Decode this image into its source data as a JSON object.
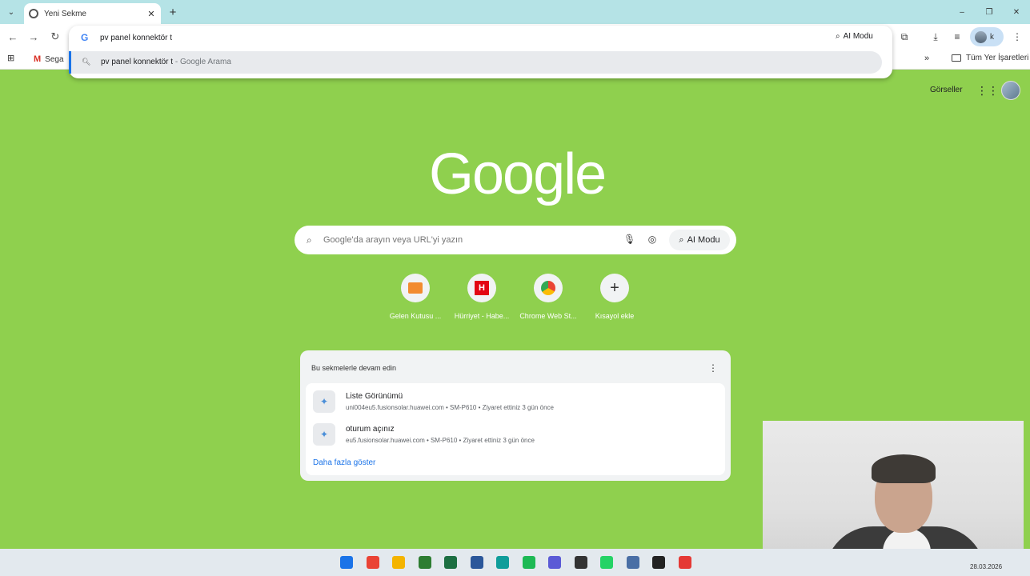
{
  "browser": {
    "tab_title": "Yeni Sekme",
    "tab_menu_icon": "chevron-down-icon",
    "newtab_icon": "+",
    "window_controls": [
      "–",
      "❐",
      "✕"
    ]
  },
  "toolbar": {
    "back": "←",
    "forward": "→",
    "reload": "↻",
    "ai_mode_label": "AI Modu",
    "profile_letter": "k"
  },
  "omnibox": {
    "value": "pv panel konnektör t",
    "suggestion_query": "pv panel konnektör t",
    "suggestion_suffix": " - Google Arama"
  },
  "bookmarks": {
    "gmail_label": "Sega",
    "more": "»",
    "all_bookmarks": "Tüm Yer İşaretleri"
  },
  "ntp": {
    "images_label": "Görseller",
    "logo": "Google",
    "search_placeholder": "Google'da arayın veya URL'yi yazın",
    "ai_mode_label": "AI Modu",
    "shortcuts": [
      {
        "label": "Gelen Kutusu ..."
      },
      {
        "label": "Hürriyet - Habe..."
      },
      {
        "label": "Chrome Web St..."
      },
      {
        "label": "Kısayol ekle"
      }
    ]
  },
  "continue_card": {
    "title": "Bu sekmelerle devam edin",
    "items": [
      {
        "title": "Liste Görünümü",
        "subtitle": "uni004eu5.fusionsolar.huawei.com • SM-P610 • Ziyaret ettiniz 3 gün önce"
      },
      {
        "title": "oturum açınız",
        "subtitle": "eu5.fusionsolar.huawei.com • SM-P610 • Ziyaret ettiniz 3 gün önce"
      }
    ],
    "more_label": "Daha fazla göster"
  },
  "taskbar": {
    "date": "28.03.2026",
    "icon_colors": [
      "#1a73e8",
      "#ea4335",
      "#f4b400",
      "#2e7d32",
      "#1d6f42",
      "#2b579a",
      "#0f9d9a",
      "#1db954",
      "#5b5bd6",
      "#333333",
      "#25d366",
      "#4a6fa5",
      "#222222",
      "#e53935"
    ]
  },
  "colors": {
    "page_bg": "#8fd04e",
    "titlebar": "#b5e3e6",
    "accent": "#1a73e8"
  }
}
